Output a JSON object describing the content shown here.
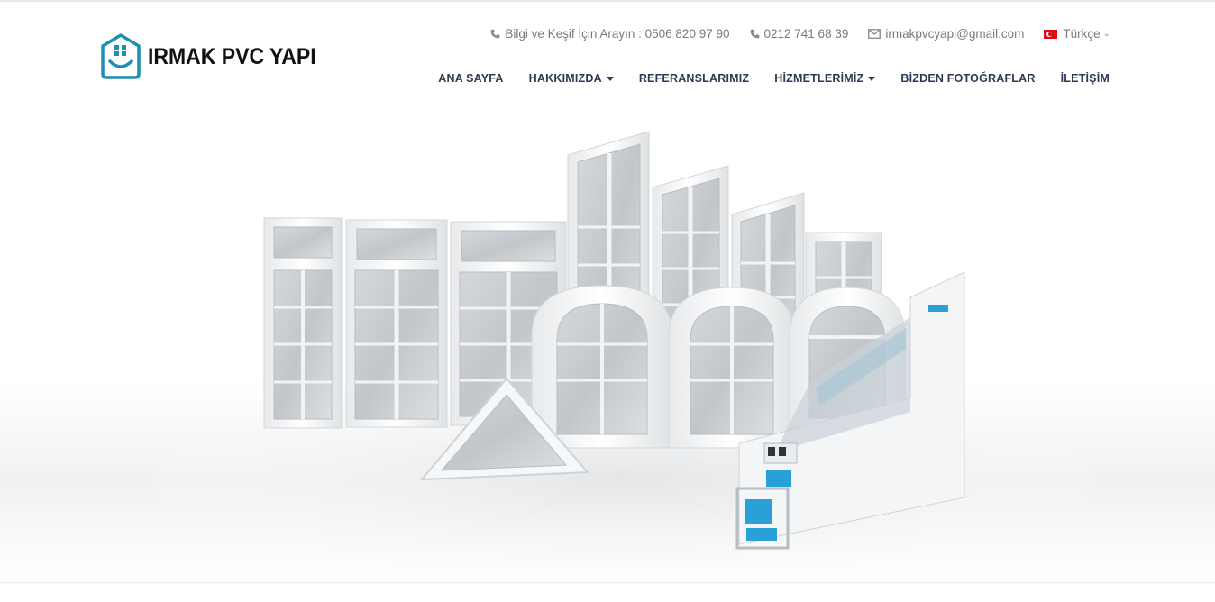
{
  "brand": {
    "name": "IRMAK PVC YAPI",
    "accent": "#1d8fb3"
  },
  "contact": {
    "phone_label": "Bilgi ve Keşif İçin Arayın : 0506 820 97 90",
    "phone2": "0212 741 68 39",
    "email": "irmakpvcyapi@gmail.com",
    "language": "Türkçe",
    "icons": {
      "phone": "phone-icon",
      "phone2": "phone-icon",
      "email": "envelope-icon",
      "language": "flag-tr-icon"
    }
  },
  "nav": {
    "items": [
      {
        "label": "ANA SAYFA",
        "dropdown": false
      },
      {
        "label": "HAKKIMIZDA",
        "dropdown": true
      },
      {
        "label": "REFERANSLARIMIZ",
        "dropdown": false
      },
      {
        "label": "HİZMETLERİMİZ",
        "dropdown": true
      },
      {
        "label": "BİZDEN FOTOĞRAFLAR",
        "dropdown": false
      },
      {
        "label": "İLETİŞİM",
        "dropdown": false
      }
    ],
    "color": "#2e3a55"
  },
  "hero": {
    "description_icon": "pvc-windows-banner",
    "glass_color": "#c9cdd1",
    "profile_blue": "#2aa0d8"
  }
}
